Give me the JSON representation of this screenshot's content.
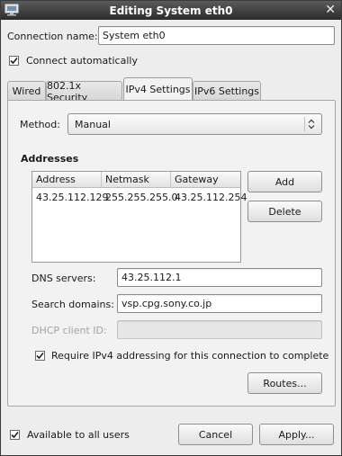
{
  "window": {
    "title": "Editing System eth0",
    "close_glyph": "✕"
  },
  "connection": {
    "name_label": "Connection name:",
    "name_value": "System eth0",
    "auto_connect_label": "Connect automatically",
    "auto_connect_checked": true
  },
  "tabs": [
    {
      "label": "Wired",
      "active": false
    },
    {
      "label": "802.1x Security",
      "active": false
    },
    {
      "label": "IPv4 Settings",
      "active": true
    },
    {
      "label": "IPv6 Settings",
      "active": false
    }
  ],
  "ipv4": {
    "method_label": "Method:",
    "method_value": "Manual",
    "addresses_heading": "Addresses",
    "columns": [
      "Address",
      "Netmask",
      "Gateway"
    ],
    "rows": [
      {
        "address": "43.25.112.129",
        "netmask": "255.255.255.0",
        "gateway": "43.25.112.254"
      }
    ],
    "add_button": "Add",
    "delete_button": "Delete",
    "dns_label": "DNS servers:",
    "dns_value": "43.25.112.1",
    "search_label": "Search domains:",
    "search_value": "vsp.cpg.sony.co.jp",
    "dhcp_label": "DHCP client ID:",
    "dhcp_value": "",
    "require_label": "Require IPv4 addressing for this connection to complete",
    "require_checked": true,
    "routes_button": "Routes..."
  },
  "footer": {
    "available_label": "Available to all users",
    "available_checked": true,
    "cancel_button": "Cancel",
    "apply_button": "Apply..."
  },
  "icons": {
    "window": "network-icon",
    "close": "close-icon",
    "combo": "combo-arrows-icon",
    "check": "checkmark-icon"
  }
}
